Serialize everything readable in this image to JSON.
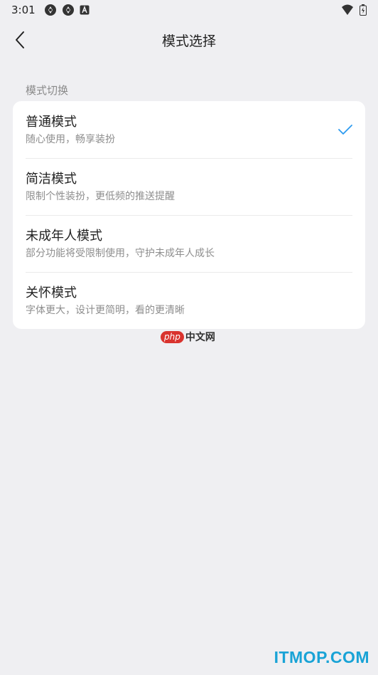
{
  "status_bar": {
    "time": "3:01",
    "left_icons": [
      "notification-icon",
      "notification-icon",
      "a-icon"
    ],
    "right_icons": [
      "wifi-icon",
      "battery-icon"
    ]
  },
  "header": {
    "title": "模式选择",
    "back_icon": "chevron-left-icon"
  },
  "section": {
    "label": "模式切换"
  },
  "options": [
    {
      "title": "普通模式",
      "description": "随心使用，畅享装扮",
      "selected": true
    },
    {
      "title": "简洁模式",
      "description": "限制个性装扮，更低频的推送提醒",
      "selected": false
    },
    {
      "title": "未成年人模式",
      "description": "部分功能将受限制使用，守护未成年人成长",
      "selected": false
    },
    {
      "title": "关怀模式",
      "description": "字体更大，设计更简明，看的更清晰",
      "selected": false
    }
  ],
  "watermarks": {
    "php_badge": "php",
    "php_text": "中文网",
    "itmop": "ITMOP.COM"
  },
  "colors": {
    "background": "#efeff2",
    "accent": "#2d9bf0",
    "watermark_blue": "#19a3d6",
    "php_red": "#d9332e"
  }
}
